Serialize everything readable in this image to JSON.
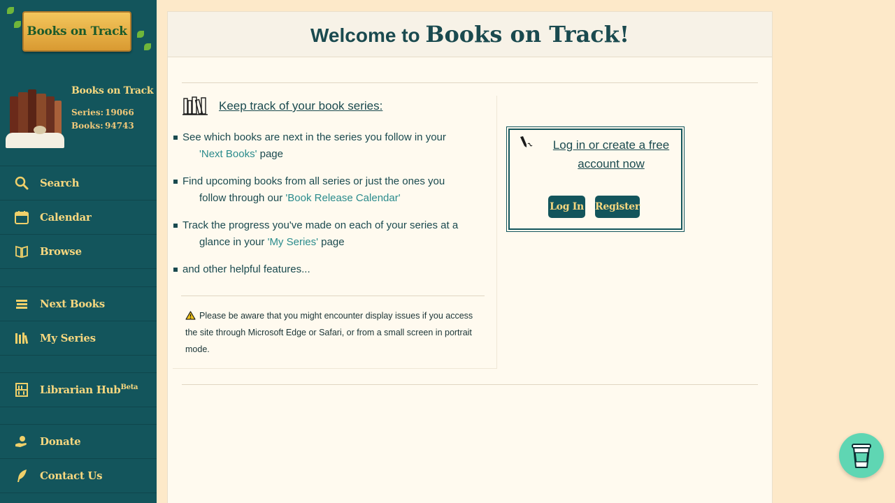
{
  "logo": {
    "text": "Books on Track"
  },
  "stats": {
    "title": "Books on Track",
    "series_label": "Series:",
    "series_value": "19066",
    "books_label": "Books:",
    "books_value": "94743"
  },
  "nav": {
    "search": "Search",
    "calendar": "Calendar",
    "browse": "Browse",
    "next_books": "Next Books",
    "my_series": "My Series",
    "librarian_hub": "Librarian Hub",
    "librarian_badge": "Beta",
    "donate": "Donate",
    "contact": "Contact Us"
  },
  "main": {
    "welcome_prefix": "Welcome to",
    "welcome_brand": "Books on Track!",
    "keep_track": "Keep track of your book series:",
    "features": [
      {
        "a": "See which books are next in the series you follow in your",
        "link": "'Next Books'",
        "b": "page"
      },
      {
        "a": "Find upcoming books from all series or just the ones you",
        "b": "follow through our",
        "link": "'Book Release Calendar'"
      },
      {
        "a": "Track the progress you've made on each of your series at a",
        "b": "glance in your",
        "link": "'My Series'",
        "c": "page"
      },
      {
        "a": "and other helpful features..."
      }
    ],
    "warning": "Please be aware that you might encounter display issues if you access the site through Microsoft Edge or Safari, or from a small screen in portrait mode."
  },
  "login": {
    "line1": "Log in or create a free",
    "line2": "account now",
    "login_button": "Log In",
    "register_button": "Register"
  },
  "colors": {
    "sidebar": "#13555c",
    "accent": "#f6d77f",
    "link": "#2a8b8c",
    "background": "#fde9c9"
  }
}
